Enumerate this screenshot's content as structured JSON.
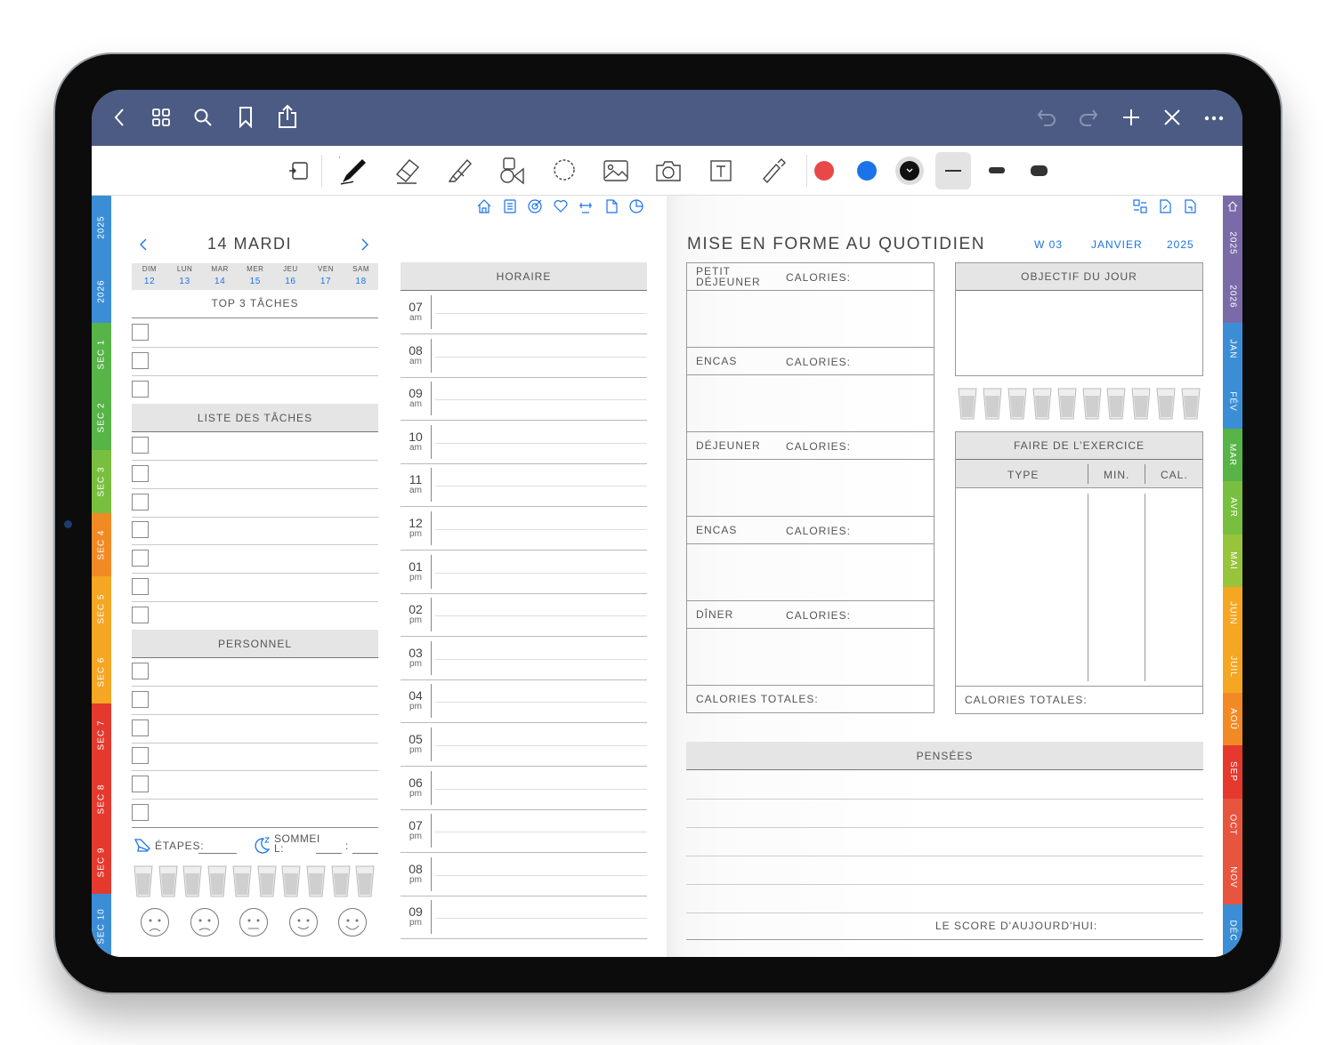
{
  "topbar": {
    "left_icons": [
      "back-icon",
      "grid-icon",
      "search-icon",
      "bookmark-icon",
      "share-icon"
    ],
    "right_icons": [
      "undo-icon",
      "redo-icon",
      "plus-icon",
      "close-icon",
      "more-icon"
    ]
  },
  "toolbar": {
    "tools": [
      "page-tool-icon",
      "pen-icon",
      "eraser-icon",
      "highlighter-icon",
      "shapes-icon",
      "lasso-icon",
      "image-icon",
      "camera-icon",
      "text-icon",
      "laser-icon"
    ],
    "colors": [
      "#e84848",
      "#1a73e8",
      "#111111"
    ]
  },
  "left_tabs": [
    "2025",
    "2026",
    "SEC 1",
    "SEC 2",
    "SEC 3",
    "SEC 4",
    "SEC 5",
    "SEC 6",
    "SEC 7",
    "SEC 8",
    "SEC 9",
    "SEC 10"
  ],
  "left_tab_colors": [
    "#3b8ed6",
    "#3b8ed6",
    "#57b447",
    "#57b447",
    "#79bf3f",
    "#f28a24",
    "#f5a623",
    "#f5a623",
    "#e5392e",
    "#e5392e",
    "#e5392e",
    "#3b8ed6"
  ],
  "right_tabs": [
    "2025",
    "2026",
    "JAN",
    "FÉV",
    "MAR",
    "AVR",
    "MAI",
    "JUIN",
    "JUIL",
    "AOÛ",
    "SEP",
    "OCT",
    "NOV",
    "DÉC"
  ],
  "right_tab_colors": [
    "#7a6aa8",
    "#7a6aa8",
    "#3b8ed6",
    "#3b8ed6",
    "#57b447",
    "#79bf3f",
    "#98c43c",
    "#f5a623",
    "#f5a623",
    "#f28a24",
    "#e5392e",
    "#e8553e",
    "#e8553e",
    "#3b8ed6"
  ],
  "nav_icons_left": [
    "home-icon",
    "notes-icon",
    "goal-icon",
    "heart-icon",
    "fitness-icon",
    "page-icon",
    "pie-icon"
  ],
  "nav_icons_right": [
    "layout-icon",
    "page-link-icon",
    "page-link-2-icon"
  ],
  "day": {
    "title": "14 MARDI",
    "prev": "‹",
    "next": "›",
    "week": [
      {
        "d": "DIM",
        "n": "12"
      },
      {
        "d": "LUN",
        "n": "13"
      },
      {
        "d": "MAR",
        "n": "14"
      },
      {
        "d": "MER",
        "n": "15"
      },
      {
        "d": "JEU",
        "n": "16"
      },
      {
        "d": "VEN",
        "n": "17"
      },
      {
        "d": "SAM",
        "n": "18"
      }
    ]
  },
  "sections": {
    "top3": "TOP 3 TÂCHES",
    "tasks": "LISTE DES TÂCHES",
    "personal": "PERSONNEL",
    "schedule": "HORAIRE"
  },
  "steps_label": "ÉTAPES:",
  "sleep_label": "SOMMEIL:",
  "sleep_sep": ":",
  "hours": [
    {
      "h": "07",
      "p": "am"
    },
    {
      "h": "08",
      "p": "am"
    },
    {
      "h": "09",
      "p": "am"
    },
    {
      "h": "10",
      "p": "am"
    },
    {
      "h": "11",
      "p": "am"
    },
    {
      "h": "12",
      "p": "pm"
    },
    {
      "h": "01",
      "p": "pm"
    },
    {
      "h": "02",
      "p": "pm"
    },
    {
      "h": "03",
      "p": "pm"
    },
    {
      "h": "04",
      "p": "pm"
    },
    {
      "h": "05",
      "p": "pm"
    },
    {
      "h": "06",
      "p": "pm"
    },
    {
      "h": "07",
      "p": "pm"
    },
    {
      "h": "08",
      "p": "pm"
    },
    {
      "h": "09",
      "p": "pm"
    }
  ],
  "fitness": {
    "title": "MISE EN FORME AU QUOTIDIEN",
    "week": "W 03",
    "month": "JANVIER",
    "year": "2025",
    "meals": [
      {
        "name": "PETIT DÉJEUNER"
      },
      {
        "name": "ENCAS"
      },
      {
        "name": "DÉJEUNER"
      },
      {
        "name": "ENCAS"
      },
      {
        "name": "DÎNER"
      }
    ],
    "calories_label": "CALORIES:",
    "total_label": "CALORIES TOTALES:",
    "goal": "OBJECTIF DU JOUR",
    "exercise": "FAIRE DE L’EXERCICE",
    "ex_cols": [
      "TYPE",
      "MIN.",
      "CAL."
    ],
    "exercise_total": "CALORIES TOTALES:",
    "thoughts": "PENSÉES",
    "score": "LE SCORE D'AUJOURD'HUI:"
  }
}
